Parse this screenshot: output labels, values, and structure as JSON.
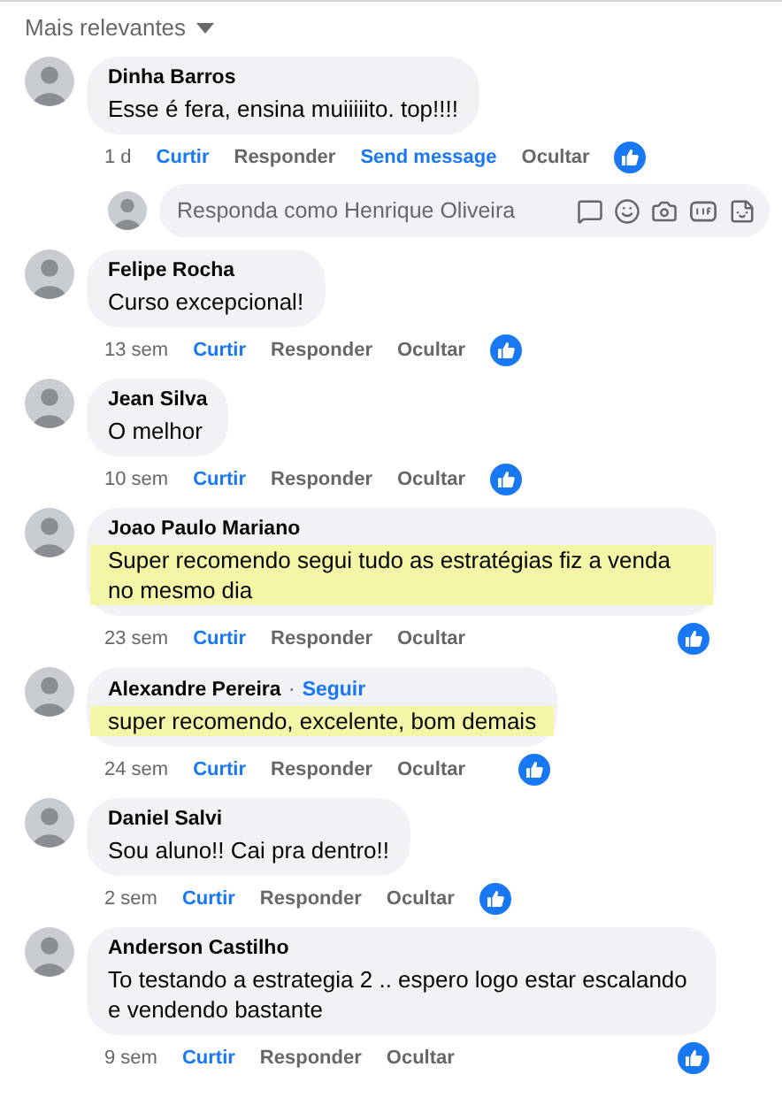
{
  "sort": {
    "label": "Mais relevantes"
  },
  "comments": [
    {
      "author": "Dinha Barros",
      "text": "Esse é fera, ensina muiiiiito. top!!!!",
      "highlighted": false,
      "time": "1 d",
      "actions": [
        {
          "label": "Curtir",
          "kind": "accent"
        },
        {
          "label": "Responder",
          "kind": "plain"
        },
        {
          "label": "Send message",
          "kind": "accent"
        },
        {
          "label": "Ocultar",
          "kind": "plain"
        }
      ],
      "reply": {
        "placeholder": "Responda como Henrique Oliveira"
      }
    },
    {
      "author": "Felipe Rocha",
      "text": "Curso excepcional!",
      "highlighted": false,
      "time": "13 sem",
      "actions": [
        {
          "label": "Curtir",
          "kind": "accent"
        },
        {
          "label": "Responder",
          "kind": "plain"
        },
        {
          "label": "Ocultar",
          "kind": "plain"
        }
      ]
    },
    {
      "author": "Jean Silva",
      "text": "O melhor",
      "highlighted": false,
      "time": "10 sem",
      "actions": [
        {
          "label": "Curtir",
          "kind": "accent"
        },
        {
          "label": "Responder",
          "kind": "plain"
        },
        {
          "label": "Ocultar",
          "kind": "plain"
        }
      ]
    },
    {
      "author": "Joao Paulo Mariano",
      "text": "Super recomendo segui tudo as estratégias fiz a venda no mesmo dia",
      "highlighted": true,
      "time": "23 sem",
      "actions": [
        {
          "label": "Curtir",
          "kind": "accent"
        },
        {
          "label": "Responder",
          "kind": "plain"
        },
        {
          "label": "Ocultar",
          "kind": "plain"
        }
      ]
    },
    {
      "author": "Alexandre Pereira",
      "separator": "·",
      "follow": "Seguir",
      "text": "super recomendo, excelente, bom demais",
      "highlighted": true,
      "time": "24 sem",
      "actions": [
        {
          "label": "Curtir",
          "kind": "accent"
        },
        {
          "label": "Responder",
          "kind": "plain"
        },
        {
          "label": "Ocultar",
          "kind": "plain"
        }
      ]
    },
    {
      "author": "Daniel Salvi",
      "text": "Sou aluno!! Cai pra dentro!!",
      "highlighted": false,
      "time": "2 sem",
      "actions": [
        {
          "label": "Curtir",
          "kind": "accent"
        },
        {
          "label": "Responder",
          "kind": "plain"
        },
        {
          "label": "Ocultar",
          "kind": "plain"
        }
      ]
    },
    {
      "author": "Anderson Castilho",
      "text": "To testando a estrategia 2 .. espero logo estar escalando e vendendo bastante",
      "highlighted": false,
      "time": "9 sem",
      "actions": [
        {
          "label": "Curtir",
          "kind": "accent"
        },
        {
          "label": "Responder",
          "kind": "plain"
        },
        {
          "label": "Ocultar",
          "kind": "plain"
        }
      ]
    }
  ]
}
